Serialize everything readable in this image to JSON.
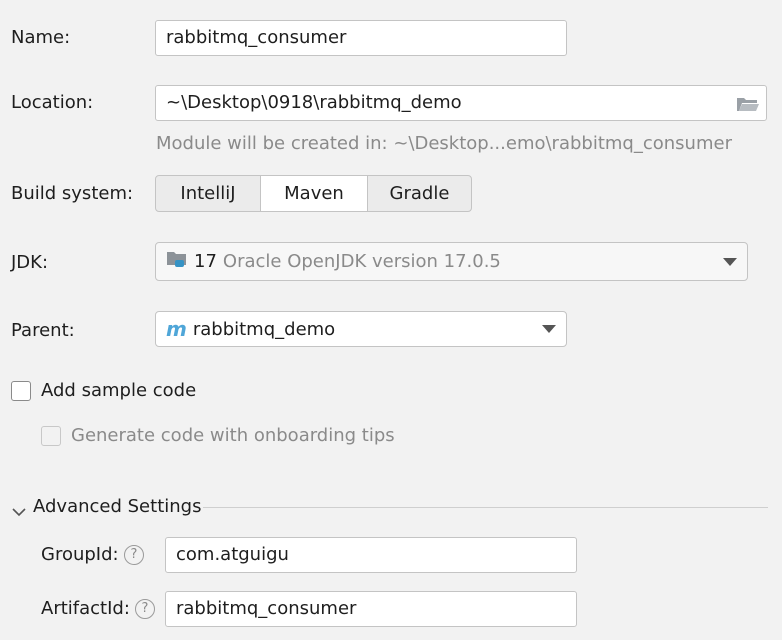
{
  "name": {
    "label": "Name:",
    "value": "rabbitmq_consumer"
  },
  "location": {
    "label": "Location:",
    "value": "~\\Desktop\\0918\\rabbitmq_demo",
    "hint": "Module will be created in: ~\\Desktop...emo\\rabbitmq_consumer"
  },
  "build_system": {
    "label": "Build system:",
    "options": [
      "IntelliJ",
      "Maven",
      "Gradle"
    ],
    "selected": "Maven"
  },
  "jdk": {
    "label": "JDK:",
    "version": "17",
    "description": "Oracle OpenJDK version 17.0.5"
  },
  "parent": {
    "label": "Parent:",
    "value": "rabbitmq_demo",
    "icon": "m"
  },
  "sample_code": {
    "label": "Add sample code",
    "checked": false
  },
  "onboarding": {
    "label": "Generate code with onboarding tips",
    "checked": false,
    "disabled": true
  },
  "advanced": {
    "title": "Advanced Settings",
    "groupid": {
      "label": "GroupId:",
      "value": "com.atguigu"
    },
    "artifactid": {
      "label": "ArtifactId:",
      "value": "rabbitmq_consumer"
    },
    "help_glyph": "?"
  },
  "colors": {
    "accent": "#3592c4",
    "maven_icon": "#4fa6d8"
  }
}
